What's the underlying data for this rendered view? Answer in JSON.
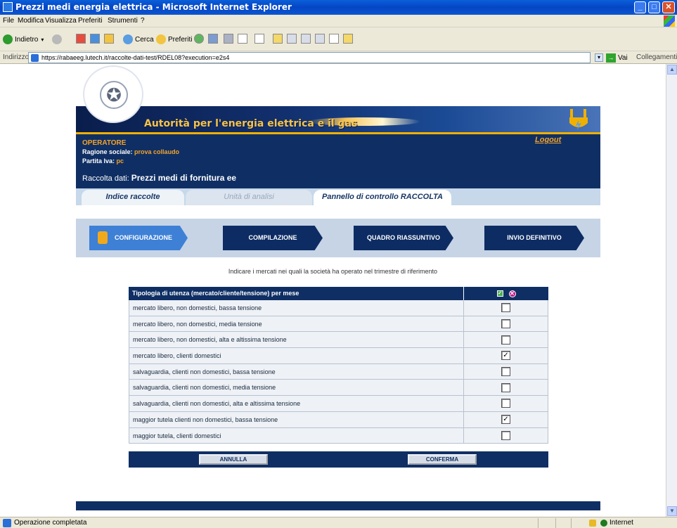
{
  "window": {
    "title": "Prezzi medi energia elettrica - Microsoft Internet Explorer"
  },
  "menubar": [
    "File",
    "Modifica",
    "Visualizza",
    "Preferiti",
    "Strumenti",
    "?"
  ],
  "toolbar": {
    "back": "Indietro",
    "search": "Cerca",
    "favorites": "Preferiti"
  },
  "address": {
    "label": "Indirizzo",
    "url": "https://rabaeeg.lutech.it/raccolte-dati-test/RDEL08?execution=e2s4",
    "go": "Vai",
    "links": "Collegamenti"
  },
  "banner": {
    "authority": "Autorità per l'energia elettrica e il gas"
  },
  "operator": {
    "heading": "OPERATORE",
    "ragione_label": "Ragione sociale:",
    "ragione_value": "prova collaudo",
    "piva_label": "Partita Iva:",
    "piva_value": "pc",
    "logout": "Logout",
    "raccolta_label": "Raccolta dati:",
    "raccolta_value": "Prezzi medi di fornitura ee"
  },
  "tabs": [
    "Indice raccolte",
    "Unità di analisi",
    "Pannello di controllo RACCOLTA"
  ],
  "steps": [
    "CONFIGURAZIONE",
    "COMPILAZIONE",
    "QUADRO RIASSUNTIVO",
    "INVIO DEFINITIVO"
  ],
  "instruction": "Indicare i mercati nei quali la società ha operato nel trimestre di riferimento",
  "table": {
    "header": "Tipologia di utenza (mercato/cliente/tensione) per mese",
    "rows": [
      {
        "label": "mercato libero, non domestici, bassa tensione",
        "checked": false
      },
      {
        "label": "mercato libero, non domestici, media tensione",
        "checked": false
      },
      {
        "label": "mercato libero, non domestici, alta e altissima tensione",
        "checked": false
      },
      {
        "label": "mercato libero, clienti domestici",
        "checked": true
      },
      {
        "label": "salvaguardia, clienti non domestici, bassa tensione",
        "checked": false
      },
      {
        "label": "salvaguardia, clienti non domestici, media tensione",
        "checked": false
      },
      {
        "label": "salvaguardia, clienti non domestici, alta e altissima tensione",
        "checked": false
      },
      {
        "label": "maggior tutela clienti non domestici, bassa tensione",
        "checked": true
      },
      {
        "label": "maggior tutela, clienti domestici",
        "checked": false
      }
    ]
  },
  "buttons": {
    "annulla": "ANNULLA",
    "conferma": "CONFERMA"
  },
  "status": {
    "text": "Operazione completata",
    "zone": "Internet"
  }
}
